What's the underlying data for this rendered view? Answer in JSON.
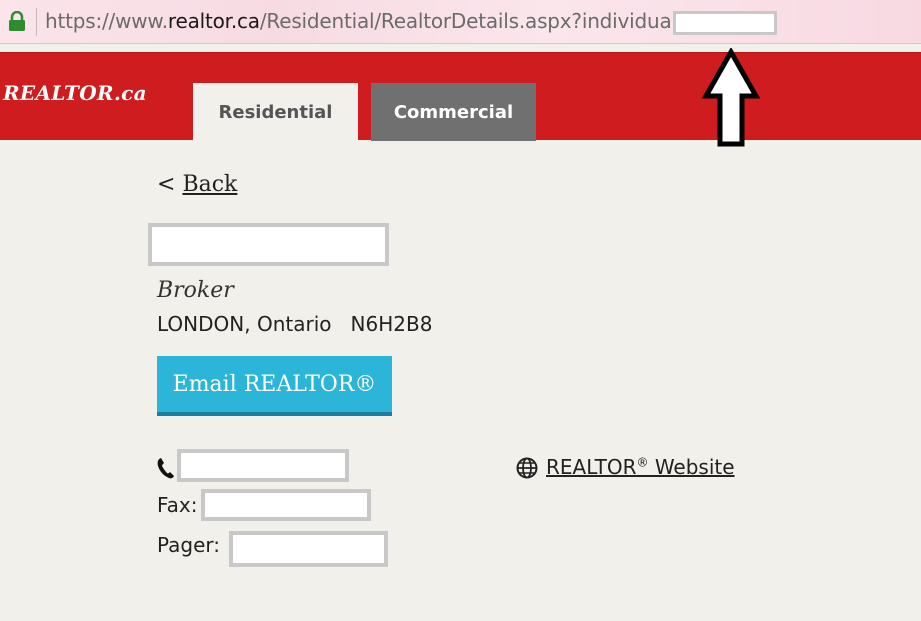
{
  "browser": {
    "url_prefix": "https://www.",
    "url_host": "realtor.ca",
    "url_path": "/Residential/RealtorDetails.aspx?individualId="
  },
  "header": {
    "logo": "REALTOR.ca",
    "tabs": [
      {
        "label": "Residential",
        "active": true
      },
      {
        "label": "Commercial",
        "active": false
      }
    ],
    "accent_color": "#cf1c1f"
  },
  "profile": {
    "back_prefix": "< ",
    "back_label": "Back",
    "role": "Broker",
    "location": "LONDON, Ontario   N6H2B8",
    "email_button": "Email REALTOR®",
    "fax_label": "Fax:",
    "pager_label": "Pager:",
    "website_label": "REALTOR",
    "website_mark": "®",
    "website_suffix": " Website"
  },
  "icons": [
    "lock-icon",
    "phone-icon",
    "globe-icon",
    "up-arrow-annotation"
  ]
}
